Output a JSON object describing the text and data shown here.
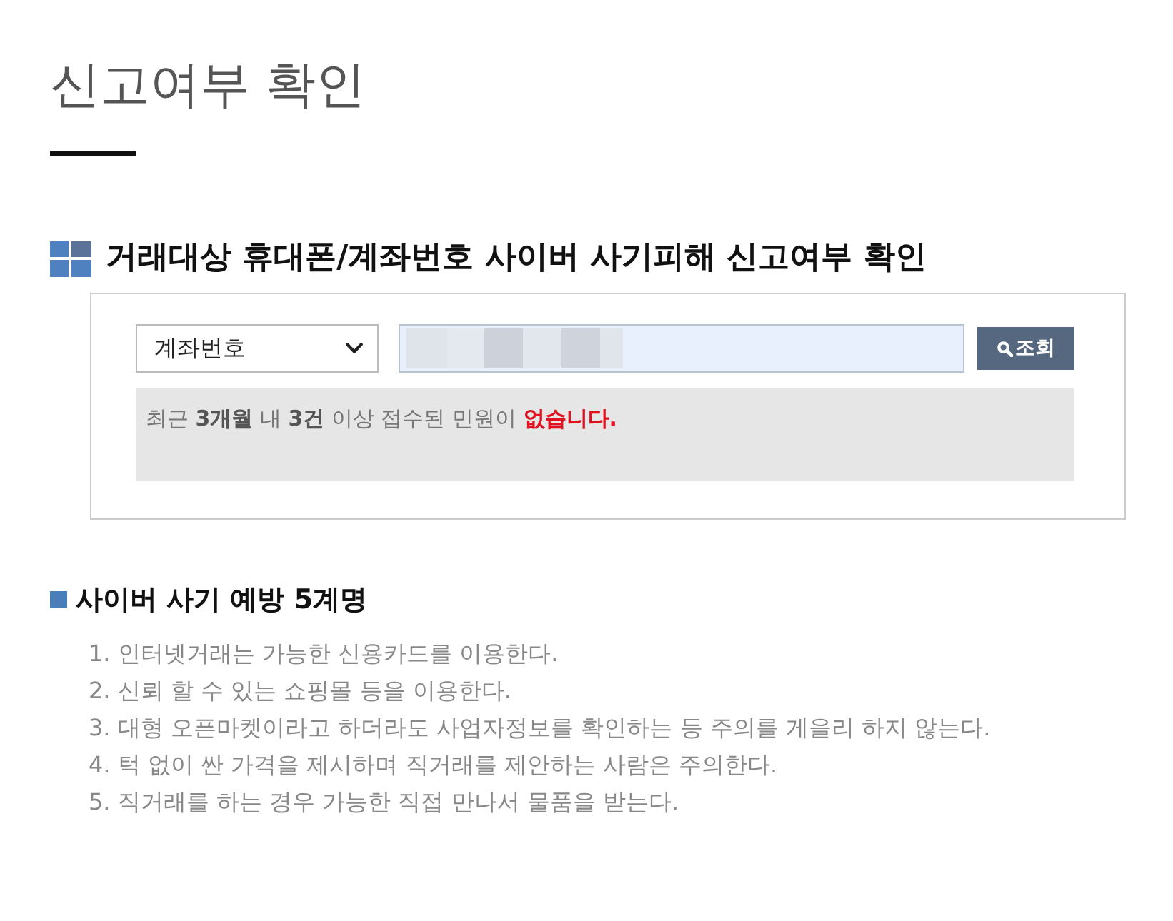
{
  "page_title": "신고여부 확인",
  "check_section": {
    "title": "거래대상 휴대폰/계좌번호 사이버 사기피해 신고여부 확인",
    "search_type": "계좌번호",
    "search_button": "조회",
    "message": {
      "text": "최근 **3개월** 내 **3건** 이상 접수된 민원이",
      "result": "없습니다."
    }
  },
  "tips_section": {
    "title": "사이버 사기 예방 5계명",
    "items": [
      "1. 인터넷거래는 가능한 신용카드를 이용한다.",
      "2. 신뢰 할 수 있는 쇼핑몰 등을 이용한다.",
      "3. 대형 오픈마켓이라고 하더라도 사업자정보를 확인하는 등 주의를 게을리 하지 않는다.",
      "4. 턱 없이 싼 가격을 제시하며 직거래를 제안하는 사람은 주의한다.",
      "5. 직거래를 하는 경우 가능한 직접 만나서 물품을 받는다."
    ]
  }
}
